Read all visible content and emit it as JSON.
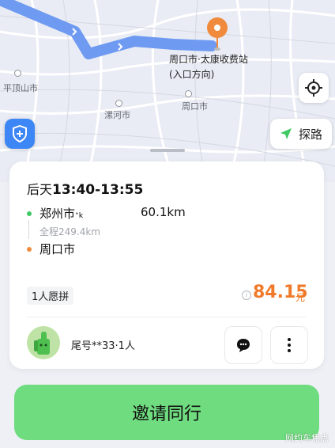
{
  "map": {
    "cities": [
      "平顶山市",
      "漯河市",
      "周口市"
    ],
    "destination": {
      "line1": "周口市·太康收费站",
      "line2": "(入口方向)"
    },
    "explore_label": "探路",
    "route_color": "#6f9af2",
    "icons": {
      "locate": "crosshair-icon",
      "safety": "shield-plus-icon",
      "explore": "navigation-arrow-icon",
      "pin": "destination-pin-icon"
    }
  },
  "trip": {
    "time_prefix": "后天",
    "time_range": "13:40-13:55",
    "origin": "郑州市·ₖ",
    "distance": "60.1km",
    "total": "全程249.4km",
    "destination": "周口市",
    "seats": "1人愿拼",
    "price": "84.15",
    "price_unit": "元",
    "price_color": "#f07a2a"
  },
  "driver": {
    "plate": "尾号**33·1人"
  },
  "invite_label": "邀请同行",
  "invite_color": "#6fdc7f",
  "watermark": "网约车焦点"
}
